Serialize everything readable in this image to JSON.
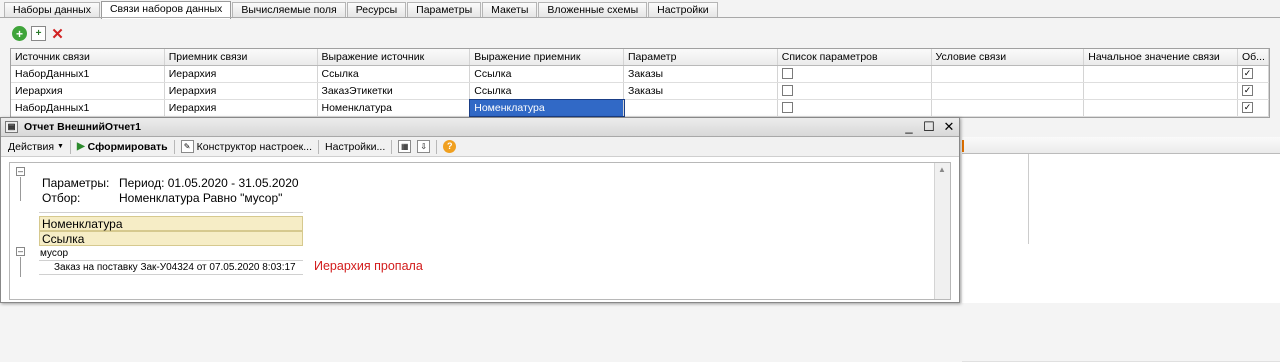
{
  "designer": {
    "tabs": [
      {
        "label": "Наборы данных",
        "active": false
      },
      {
        "label": "Связи наборов данных",
        "active": true
      },
      {
        "label": "Вычисляемые поля",
        "active": false
      },
      {
        "label": "Ресурсы",
        "active": false
      },
      {
        "label": "Параметры",
        "active": false
      },
      {
        "label": "Макеты",
        "active": false
      },
      {
        "label": "Вложенные схемы",
        "active": false
      },
      {
        "label": "Настройки",
        "active": false
      }
    ],
    "toolbar_icons": [
      "add-icon",
      "copy-icon",
      "delete-icon"
    ],
    "columns": [
      "Источник связи",
      "Приемник связи",
      "Выражение источник",
      "Выражение приемник",
      "Параметр",
      "Список параметров",
      "Условие связи",
      "Начальное значение связи",
      "Об..."
    ],
    "rows": [
      {
        "source": "НаборДанных1",
        "receiver": "Иерархия",
        "src_expr": "Ссылка",
        "rcv_expr": "Ссылка",
        "param": "Заказы",
        "param_list": false,
        "condition": "",
        "initial": "",
        "required": true
      },
      {
        "source": "Иерархия",
        "receiver": "Иерархия",
        "src_expr": "ЗаказЭтикетки",
        "rcv_expr": "Ссылка",
        "param": "Заказы",
        "param_list": false,
        "condition": "",
        "initial": "",
        "required": true
      },
      {
        "source": "НаборДанных1",
        "receiver": "Иерархия",
        "src_expr": "Номенклатура",
        "rcv_expr": "Номенклатура",
        "param": "",
        "param_list": false,
        "condition": "",
        "initial": "",
        "required": true,
        "selected_cell": "rcv_expr"
      }
    ]
  },
  "report": {
    "title": "Отчет  ВнешнийОтчет1",
    "window_buttons": [
      "minimize-icon",
      "maximize-icon",
      "close-icon"
    ],
    "toolbar": {
      "actions": "Действия",
      "generate": "Сформировать",
      "constructor": "Конструктор настроек...",
      "settings": "Настройки..."
    },
    "params_label": "Параметры:",
    "params_value": "Период: 01.05.2020 - 31.05.2020",
    "filter_label": "Отбор:",
    "filter_value": "Номенклатура Равно \"мусор\"",
    "headers": [
      "Номенклатура",
      "Ссылка"
    ],
    "group_value": "мусор",
    "detail_value": "Заказ на поставку Зак-У04324 от 07.05.2020 8:03:17",
    "note": "Иерархия пропала"
  },
  "colors": {
    "selection": "#3169c6",
    "header_fill": "#f6edc6",
    "note": "#d21c1c"
  }
}
